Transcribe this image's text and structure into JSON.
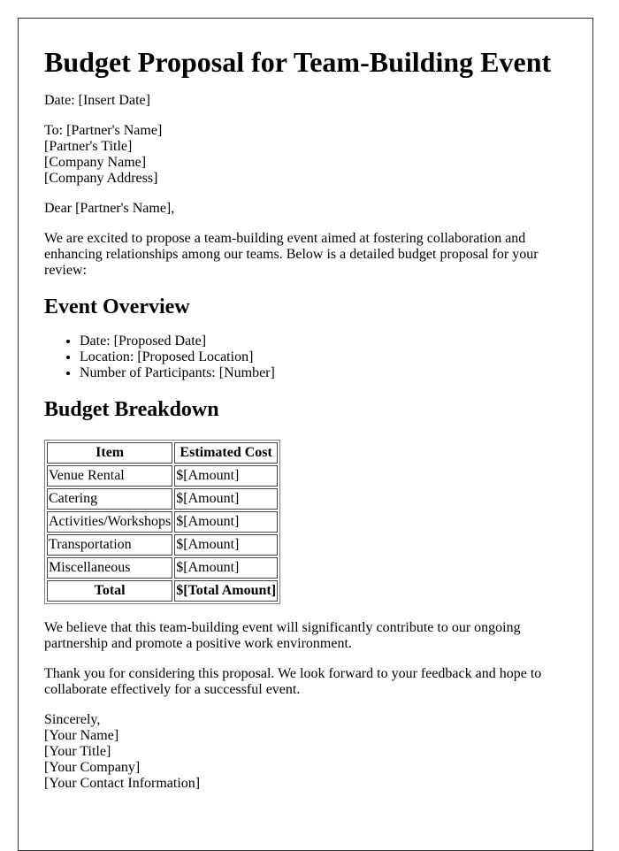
{
  "document": {
    "title": "Budget Proposal for Team-Building Event",
    "date_line": "Date: [Insert Date]",
    "recipient": [
      "To: [Partner's Name]",
      "[Partner's Title]",
      "[Company Name]",
      "[Company Address]"
    ],
    "greeting": "Dear [Partner's Name],",
    "intro": "We are excited to propose a team-building event aimed at fostering collaboration and enhancing relationships among our teams. Below is a detailed budget proposal for your review:",
    "overview": {
      "heading": "Event Overview",
      "items": [
        "Date: [Proposed Date]",
        "Location: [Proposed Location]",
        "Number of Participants: [Number]"
      ]
    },
    "budget": {
      "heading": "Budget Breakdown",
      "columns": [
        "Item",
        "Estimated Cost"
      ],
      "rows": [
        {
          "item": "Venue Rental",
          "cost": "$[Amount]"
        },
        {
          "item": "Catering",
          "cost": "$[Amount]"
        },
        {
          "item": "Activities/Workshops",
          "cost": "$[Amount]"
        },
        {
          "item": "Transportation",
          "cost": "$[Amount]"
        },
        {
          "item": "Miscellaneous",
          "cost": "$[Amount]"
        }
      ],
      "total": {
        "label": "Total",
        "value": "$[Total Amount]"
      }
    },
    "closing_paragraph_1": "We believe that this team-building event will significantly contribute to our ongoing partnership and promote a positive work environment.",
    "closing_paragraph_2": "Thank you for considering this proposal. We look forward to your feedback and hope to collaborate effectively for a successful event.",
    "signoff": [
      "Sincerely,",
      "[Your Name]",
      "[Your Title]",
      "[Your Company]",
      "[Your Contact Information]"
    ]
  }
}
